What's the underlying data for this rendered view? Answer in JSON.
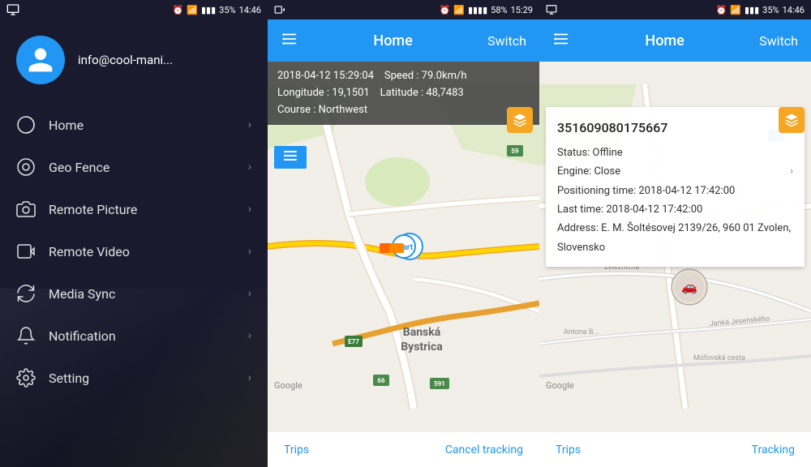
{
  "panel1": {
    "statusBar": {
      "battery": "35%",
      "time": "14:46"
    },
    "user": {
      "email": "info@cool-mani..."
    },
    "menuItems": [
      {
        "id": "home",
        "label": "Home",
        "icon": "home"
      },
      {
        "id": "geo-fence",
        "label": "Geo Fence",
        "icon": "geo-fence"
      },
      {
        "id": "remote-picture",
        "label": "Remote Picture",
        "icon": "camera"
      },
      {
        "id": "remote-video",
        "label": "Remote Video",
        "icon": "video"
      },
      {
        "id": "media-sync",
        "label": "Media Sync",
        "icon": "sync"
      },
      {
        "id": "notification",
        "label": "Notification",
        "icon": "bell"
      },
      {
        "id": "setting",
        "label": "Setting",
        "icon": "settings"
      }
    ]
  },
  "panel2": {
    "statusBar": {
      "battery": "58%",
      "time": "15:29"
    },
    "header": {
      "title": "Home",
      "switchLabel": "Switch"
    },
    "infoOverlay": {
      "datetime": "2018-04-12 15:29:04",
      "speed": "Speed : 79.0km/h",
      "longitude": "Longitude : 19,1501",
      "latitude": "Latitude : 48,7483",
      "course": "Course : Northwest"
    },
    "footer": {
      "tripsLabel": "Trips",
      "cancelLabel": "Cancel tracking"
    }
  },
  "panel3": {
    "statusBar": {
      "battery": "35%",
      "time": "14:46"
    },
    "header": {
      "title": "Home",
      "switchLabel": "Switch"
    },
    "deviceInfo": {
      "deviceId": "351609080175667",
      "status": "Status:  Offline",
      "engine": "Engine:  Close",
      "positioningTime": "Positioning time:  2018-04-12 17:42:00",
      "lastTime": "Last time:  2018-04-12 17:42:00",
      "address": "Address:  E. M. Šoltésovej 2139/26, 960 01 Zvolen, Slovensko"
    },
    "footer": {
      "tripsLabel": "Trips",
      "trackingLabel": "Tracking"
    }
  }
}
